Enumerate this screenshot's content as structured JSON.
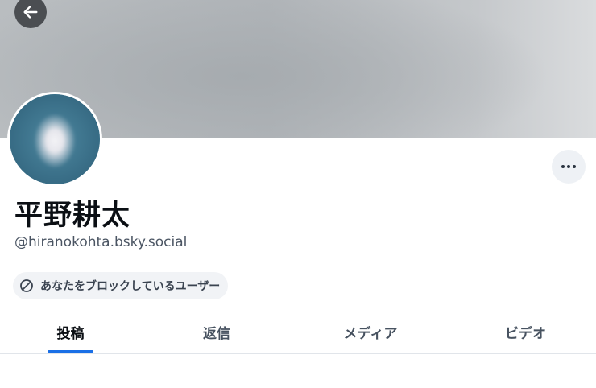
{
  "profile": {
    "display_name": "平野耕太",
    "handle": "@hiranokohta.bsky.social",
    "blocked_notice": "あなたをブロックしているユーザー"
  },
  "tabs": [
    {
      "label": "投稿",
      "active": true
    },
    {
      "label": "返信",
      "active": false
    },
    {
      "label": "メディア",
      "active": false
    },
    {
      "label": "ビデオ",
      "active": false
    }
  ],
  "icons": {
    "back": "arrow-left-icon",
    "more": "more-horizontal-icon",
    "blocked": "ban-icon"
  },
  "colors": {
    "accent": "#1a6fe6",
    "back_button": "#4b4e52",
    "avatar": "#3d7690"
  }
}
